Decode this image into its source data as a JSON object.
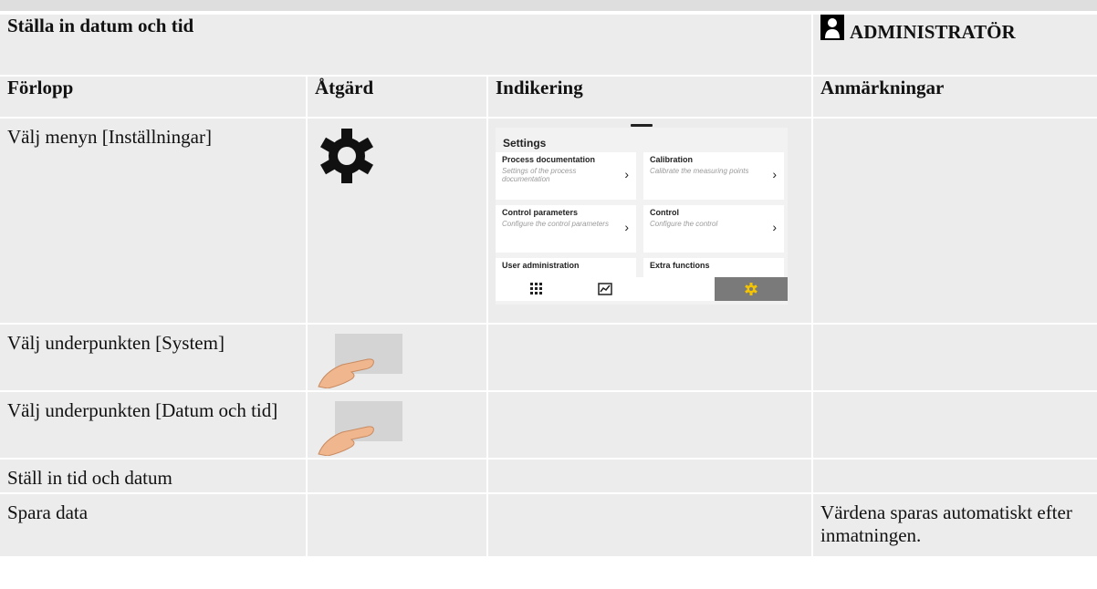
{
  "doc": {
    "title": "Ställa in datum och tid",
    "role": "ADMINISTRATÖR",
    "columns": [
      "Förlopp",
      "Åtgärd",
      "Indikering",
      "Anmärkningar"
    ],
    "rows": [
      {
        "step": "Välj menyn [Inställningar]",
        "action_icon": "gear-icon",
        "note": ""
      },
      {
        "step": "Välj underpunkten [System]",
        "action_icon": "finger-tap-icon",
        "note": ""
      },
      {
        "step": "Välj underpunkten [Datum och tid]",
        "action_icon": "finger-tap-icon",
        "note": ""
      },
      {
        "step": "Ställ in tid och datum",
        "action_icon": "",
        "note": ""
      },
      {
        "step": "Spara data",
        "action_icon": "",
        "note": "Värdena sparas automatiskt efter inmatningen."
      }
    ]
  },
  "settings_screen": {
    "title": "Settings",
    "tiles": [
      {
        "title": "Process documentation",
        "desc": "Settings of the process documentation"
      },
      {
        "title": "Calibration",
        "desc": "Calibrate the measuring points"
      },
      {
        "title": "Control parameters",
        "desc": "Configure the control parameters"
      },
      {
        "title": "Control",
        "desc": "Configure the control"
      },
      {
        "title": "User administration",
        "desc": ""
      },
      {
        "title": "Extra functions",
        "desc": ""
      }
    ],
    "nav": [
      "grid-icon",
      "chart-icon",
      "gear-icon"
    ],
    "active_nav": "gear-icon"
  }
}
